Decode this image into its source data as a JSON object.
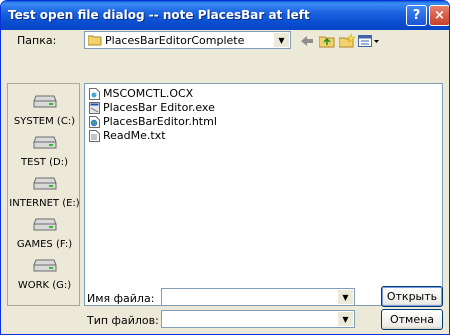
{
  "window": {
    "title": "Test open file dialog -- note PlacesBar at left",
    "help_label": "?",
    "close_label": "×"
  },
  "lookin": {
    "label": "Папка:",
    "value": "PlacesBarEditorComplete"
  },
  "places": [
    {
      "label": "SYSTEM (C:)",
      "icon": "hard-drive-icon"
    },
    {
      "label": "TEST (D:)",
      "icon": "hard-drive-icon"
    },
    {
      "label": "INTERNET (E:)",
      "icon": "hard-drive-icon"
    },
    {
      "label": "GAMES (F:)",
      "icon": "hard-drive-icon"
    },
    {
      "label": "WORK (G:)",
      "icon": "hard-drive-icon"
    }
  ],
  "files": [
    {
      "name": "MSCOMCTL.OCX",
      "icon": "activex-file-icon"
    },
    {
      "name": "PlacesBar Editor.exe",
      "icon": "exe-file-icon"
    },
    {
      "name": "PlacesBarEditor.html",
      "icon": "html-file-icon"
    },
    {
      "name": "ReadMe.txt",
      "icon": "text-file-icon"
    }
  ],
  "filename": {
    "label": "Имя файла:",
    "value": ""
  },
  "filetype": {
    "label": "Тип файлов:",
    "value": ""
  },
  "buttons": {
    "open": "Открыть",
    "cancel": "Отмена"
  },
  "colors": {
    "titlebar": "#0a50d2",
    "dialog_bg": "#ece9d8",
    "field_border": "#7f9db9",
    "close_button": "#c8402a"
  }
}
